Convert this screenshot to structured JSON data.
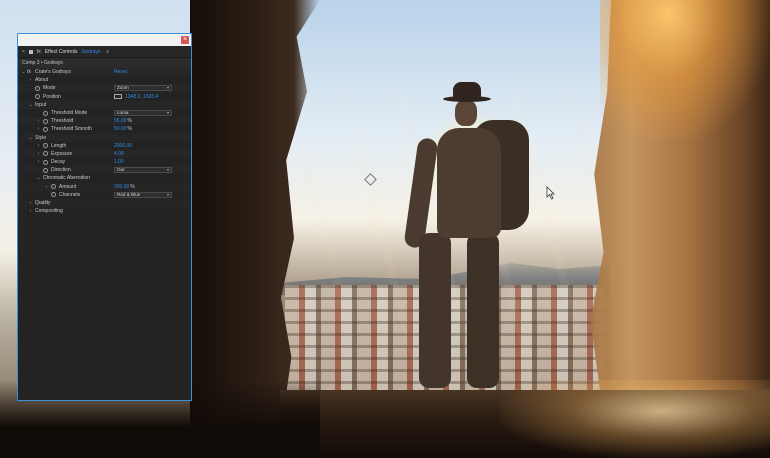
{
  "panel": {
    "title": "Effect Controls",
    "comp_tab": "Godrays",
    "breadcrumb": "Comp 3 • Godrays",
    "effect": {
      "fx": "fx",
      "name": "Crate's Godrays",
      "reset": "Reset"
    },
    "rows": {
      "about": "About",
      "mode": {
        "label": "Mode",
        "value": "Zoom"
      },
      "position": {
        "label": "Position",
        "value": "1348.3 ,1603.4"
      },
      "input": "Input",
      "threshold_mode": {
        "label": "Threshold Mode",
        "value": "Luma"
      },
      "threshold": {
        "label": "Threshold",
        "value": "55.00",
        "unit": "%"
      },
      "threshold_smooth": {
        "label": "Threshold Smooth",
        "value": "50.00",
        "unit": "%"
      },
      "style": "Style",
      "length": {
        "label": "Length",
        "value": "2000.00"
      },
      "exposure": {
        "label": "Exposure",
        "value": "4.00"
      },
      "decay": {
        "label": "Decay",
        "value": "1.00"
      },
      "direction": {
        "label": "Direction",
        "value": "Out"
      },
      "chromatic_aberration": "Chromatic Aberration",
      "amount": {
        "label": "Amount",
        "value": "200.00",
        "unit": "%"
      },
      "channels": {
        "label": "Channels",
        "value": "Red & Blue"
      },
      "quality": "Quality",
      "compositing": "Compositing"
    },
    "icons": {
      "close": "close-icon",
      "twirl": "twirl-arrow-icon",
      "stopwatch": "stopwatch-icon",
      "dropdown": "chevron-down-icon",
      "menu": "panel-menu-icon"
    }
  },
  "colors": {
    "accent": "#2d8ceb",
    "panel_bg": "#232323",
    "panel_border": "#3b8ed8"
  }
}
